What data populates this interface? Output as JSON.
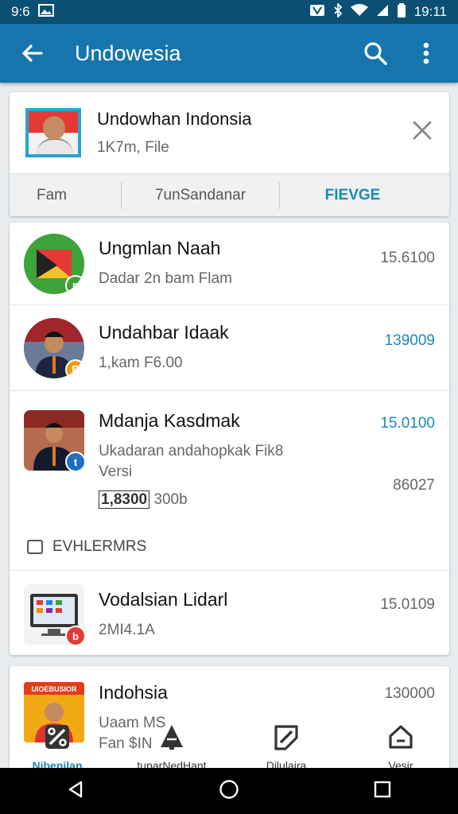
{
  "status_bar": {
    "time_left": "9:6",
    "time_right": "19:11",
    "color": "#0b4f72"
  },
  "app_bar": {
    "title": "Undowesia",
    "color": "#1775ad",
    "icons": [
      "back-arrow-icon",
      "search-icon",
      "more-vert-icon"
    ]
  },
  "top_card": {
    "title": "Undowhan Indonsia",
    "subtitle": "1K7m, File",
    "tabs": [
      {
        "label": "Fam",
        "active": false
      },
      {
        "label": "7unSandanar",
        "active": false
      },
      {
        "label": "FIEVGE",
        "active": true
      }
    ]
  },
  "list": [
    {
      "name": "Ungmlan Naah",
      "sub": "Dadar 2n bam Flam",
      "value": "15.6100",
      "value_highlight": false,
      "badge": "n",
      "badge_color": "#3da33a"
    },
    {
      "name": "Undahbar Idaak",
      "sub": "1,kam F6.00",
      "value": "139009",
      "value_highlight": true,
      "badge": "B",
      "badge_color": "#f39c12"
    },
    {
      "name": "Mdanja Kasdmak",
      "sub": "Ukadaran andahopkak Fik8",
      "sub2": "Versi",
      "sub3_boxed": "1,8300",
      "sub3_rest": "300b",
      "value": "15.0100",
      "value_highlight": true,
      "value2": "86027",
      "badge": "t",
      "badge_color": "#1e6fbf"
    }
  ],
  "section": {
    "label": "EVHLERMRS"
  },
  "section_items": [
    {
      "name": "Vodalsian Lidarl",
      "sub": "2MI4.1A",
      "value": "15.0109",
      "badge": "b",
      "badge_color": "#e53935"
    }
  ],
  "bottom_card": {
    "name": "Indohsia",
    "sub": "Uaam MS",
    "sub2": "Fan $IN",
    "value": "130000",
    "thumb_text": "UIOEBUSIOR"
  },
  "bottom_nav": [
    {
      "label": "Nibenilan",
      "icon": "tools-icon",
      "active": true
    },
    {
      "label": "tuparNedHant",
      "icon": "tree-icon",
      "active": false
    },
    {
      "label": "Dilulaira",
      "icon": "edit-tag-icon",
      "active": false
    },
    {
      "label": "Vesir",
      "icon": "home-icon",
      "active": false
    }
  ],
  "colors": {
    "accent": "#1a87b8"
  }
}
